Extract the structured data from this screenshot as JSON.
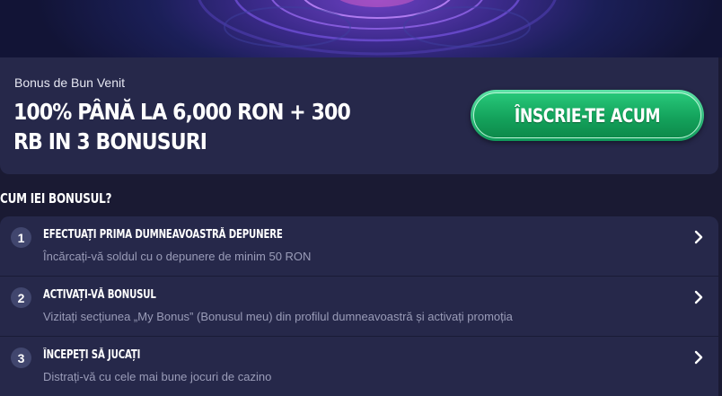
{
  "hero": {
    "image": "galaxy-swirl-banner"
  },
  "offer": {
    "subtitle": "Bonus de Bun Venit",
    "title": "100% PÂNĂ LA 6,000 RON + 300 RB IN 3 BONUSURI",
    "cta_label": "ÎNSCRIE-TE ACUM"
  },
  "how_to": {
    "heading": "CUM IEI BONUSUL?",
    "steps": [
      {
        "number": "1",
        "title": "EFECTUAȚI PRIMA DUMNEAVOASTRĂ DEPUNERE",
        "description": "Încărcați-vă soldul cu o depunere de minim 50 RON"
      },
      {
        "number": "2",
        "title": "ACTIVAȚI-VĂ BONUSUL",
        "description": "Vizitați secțiunea „My Bonus” (Bonusul meu) din profilul dumneavoastră și activați promoția"
      },
      {
        "number": "3",
        "title": "ÎNCEPEȚI SĂ JUCAȚI",
        "description": "Distrați-vă cu cele mai bune jocuri de cazino"
      }
    ]
  },
  "colors": {
    "accent_green": "#14a35c",
    "card_bg": "#26284a",
    "page_bg": "#1a1a33"
  }
}
